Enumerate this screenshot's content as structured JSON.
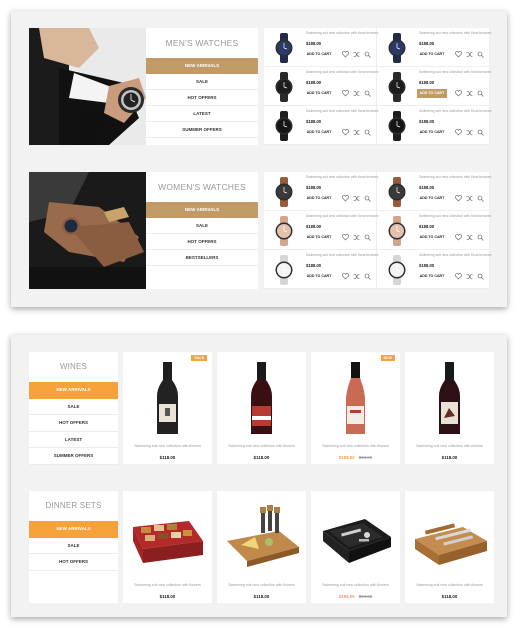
{
  "mens": {
    "title": "MEN'S WATCHES",
    "menu": [
      "NEW ARRIVALS",
      "SALE",
      "HOT OFFERS",
      "LATEST",
      "SUMMER OFFERS"
    ]
  },
  "womens": {
    "title": "WOMEN'S WATCHES",
    "menu": [
      "NEW ARRIVALS",
      "SALE",
      "HOT OFFERS",
      "BESTSELLERS"
    ]
  },
  "watch_item": {
    "desc": "Swimming suit new collection with floral textures",
    "price": "$188.00",
    "add_to_cart": "ADD TO CART"
  },
  "wines": {
    "title": "WINES",
    "menu": [
      "NEW ARRIVALS",
      "SALE",
      "HOT OFFERS",
      "LATEST",
      "SUMMER OFFERS"
    ]
  },
  "dinner": {
    "title": "DINNER SETS",
    "menu": [
      "NEW ARRIVALS",
      "SALE",
      "HOT OFFERS"
    ]
  },
  "product_item": {
    "desc": "Swimming suit new collection with flowers",
    "price": "$118.00",
    "sale_price": "$198.00",
    "old_price": "$98.00"
  },
  "badges": {
    "sale": "SALE",
    "new": "NEW"
  },
  "colors": {
    "gold": "#c19a66",
    "orange": "#f5a23a"
  },
  "icons": [
    "heart-icon",
    "shuffle-icon",
    "search-icon"
  ]
}
